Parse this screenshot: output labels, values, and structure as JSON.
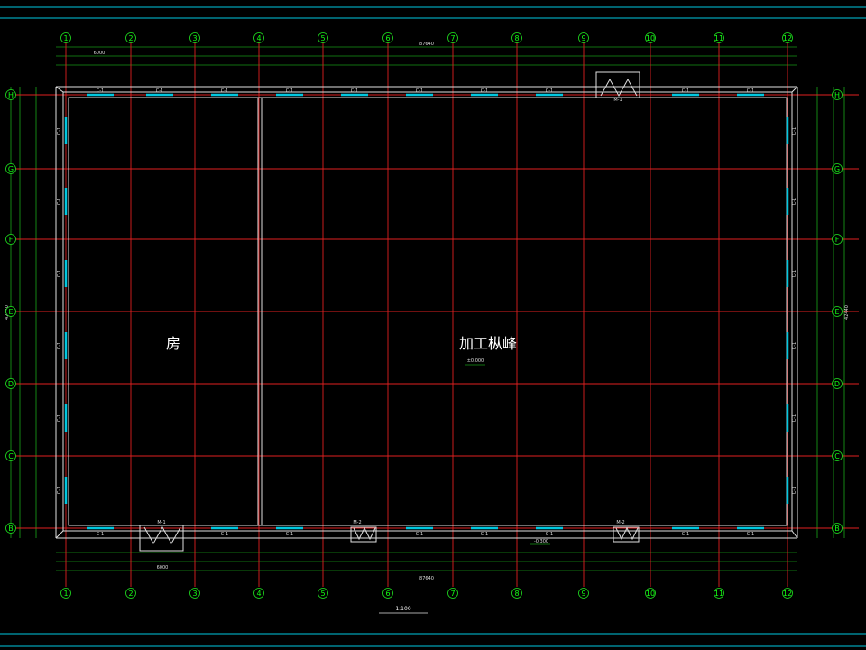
{
  "colors": {
    "background": "#000000",
    "frame": "#00c8e0",
    "grid": "#e02020",
    "dimension": "#20e020",
    "wall": "#e0e0e0",
    "window": "#00c8e0"
  },
  "rooms": {
    "left_label": "房",
    "right_label": "加工枞峰"
  },
  "axes": {
    "vertical": [
      "1",
      "2",
      "3",
      "4",
      "5",
      "6",
      "7",
      "8",
      "9",
      "10",
      "11",
      "12"
    ],
    "horizontal": [
      "A",
      "B",
      "C",
      "D",
      "E",
      "F",
      "G",
      "H"
    ]
  },
  "windows": {
    "top_label": "C-1",
    "side_label": "C-1",
    "bottom_label": "C-1"
  },
  "doors": {
    "big_door_label": "M-1",
    "small_door_label": "M-2"
  },
  "dimensions": {
    "overall_width": "87640",
    "overall_depth": "42440",
    "bay_width": "6000"
  },
  "elevation": {
    "floor_level": "±0.000",
    "outside_level": "-0.300"
  },
  "title": {
    "drawing_title": "1:100"
  }
}
